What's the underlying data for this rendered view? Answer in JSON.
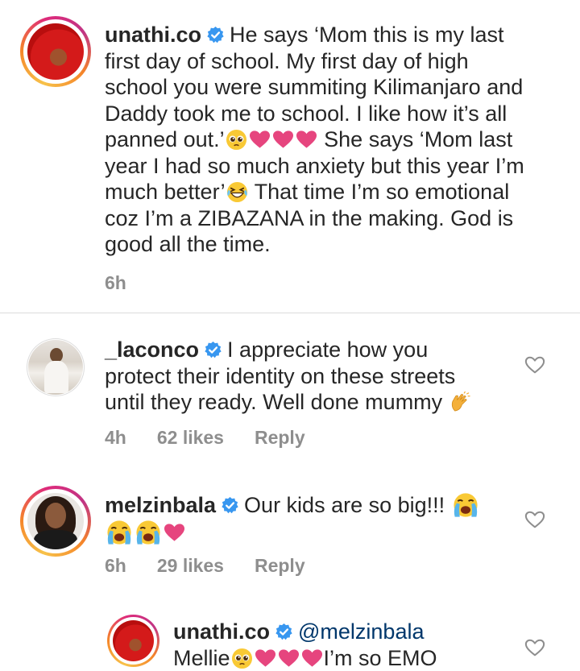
{
  "comments": [
    {
      "username": "unathi.co",
      "segments": {
        "s1": "He says ‘Mom this is my last first day of school. My first day of high school you were summiting Kilimanjaro and Daddy took me to school. I like how it’s all panned out.’",
        "s2": "She says ‘Mom last year I had so much anxiety but this year I’m much better’",
        "s3": "That time I’m so emotional coz I’m a ZIBAZANA in the making. God is good all the time."
      },
      "time": "6h"
    },
    {
      "username": "_laconco",
      "segments": {
        "s1": "I appreciate how you protect their identity on these streets until they ready. Well done mummy"
      },
      "time": "4h",
      "likes": "62 likes",
      "reply": "Reply"
    },
    {
      "username": "melzinbala",
      "segments": {
        "s1": "Our kids are so big!!!"
      },
      "time": "6h",
      "likes": "29 likes",
      "reply": "Reply"
    },
    {
      "username": "unathi.co",
      "mention": "@melzinbala",
      "segments": {
        "s1": "Mellie",
        "s2": "I’m so EMO"
      }
    }
  ],
  "icons": {
    "verified": "verified-badge-icon",
    "like": "heart-outline-icon",
    "pleading": "pleading-face-emoji",
    "heart": "pink-heart-emoji",
    "grin": "grinning-squinting-face-emoji",
    "clap": "clapping-hands-emoji",
    "crying": "loudly-crying-face-emoji"
  },
  "colors": {
    "text": "#262626",
    "meta": "#8e8e8e",
    "verified": "#3897f0",
    "heart": "#e6457e",
    "mention": "#00376b"
  }
}
